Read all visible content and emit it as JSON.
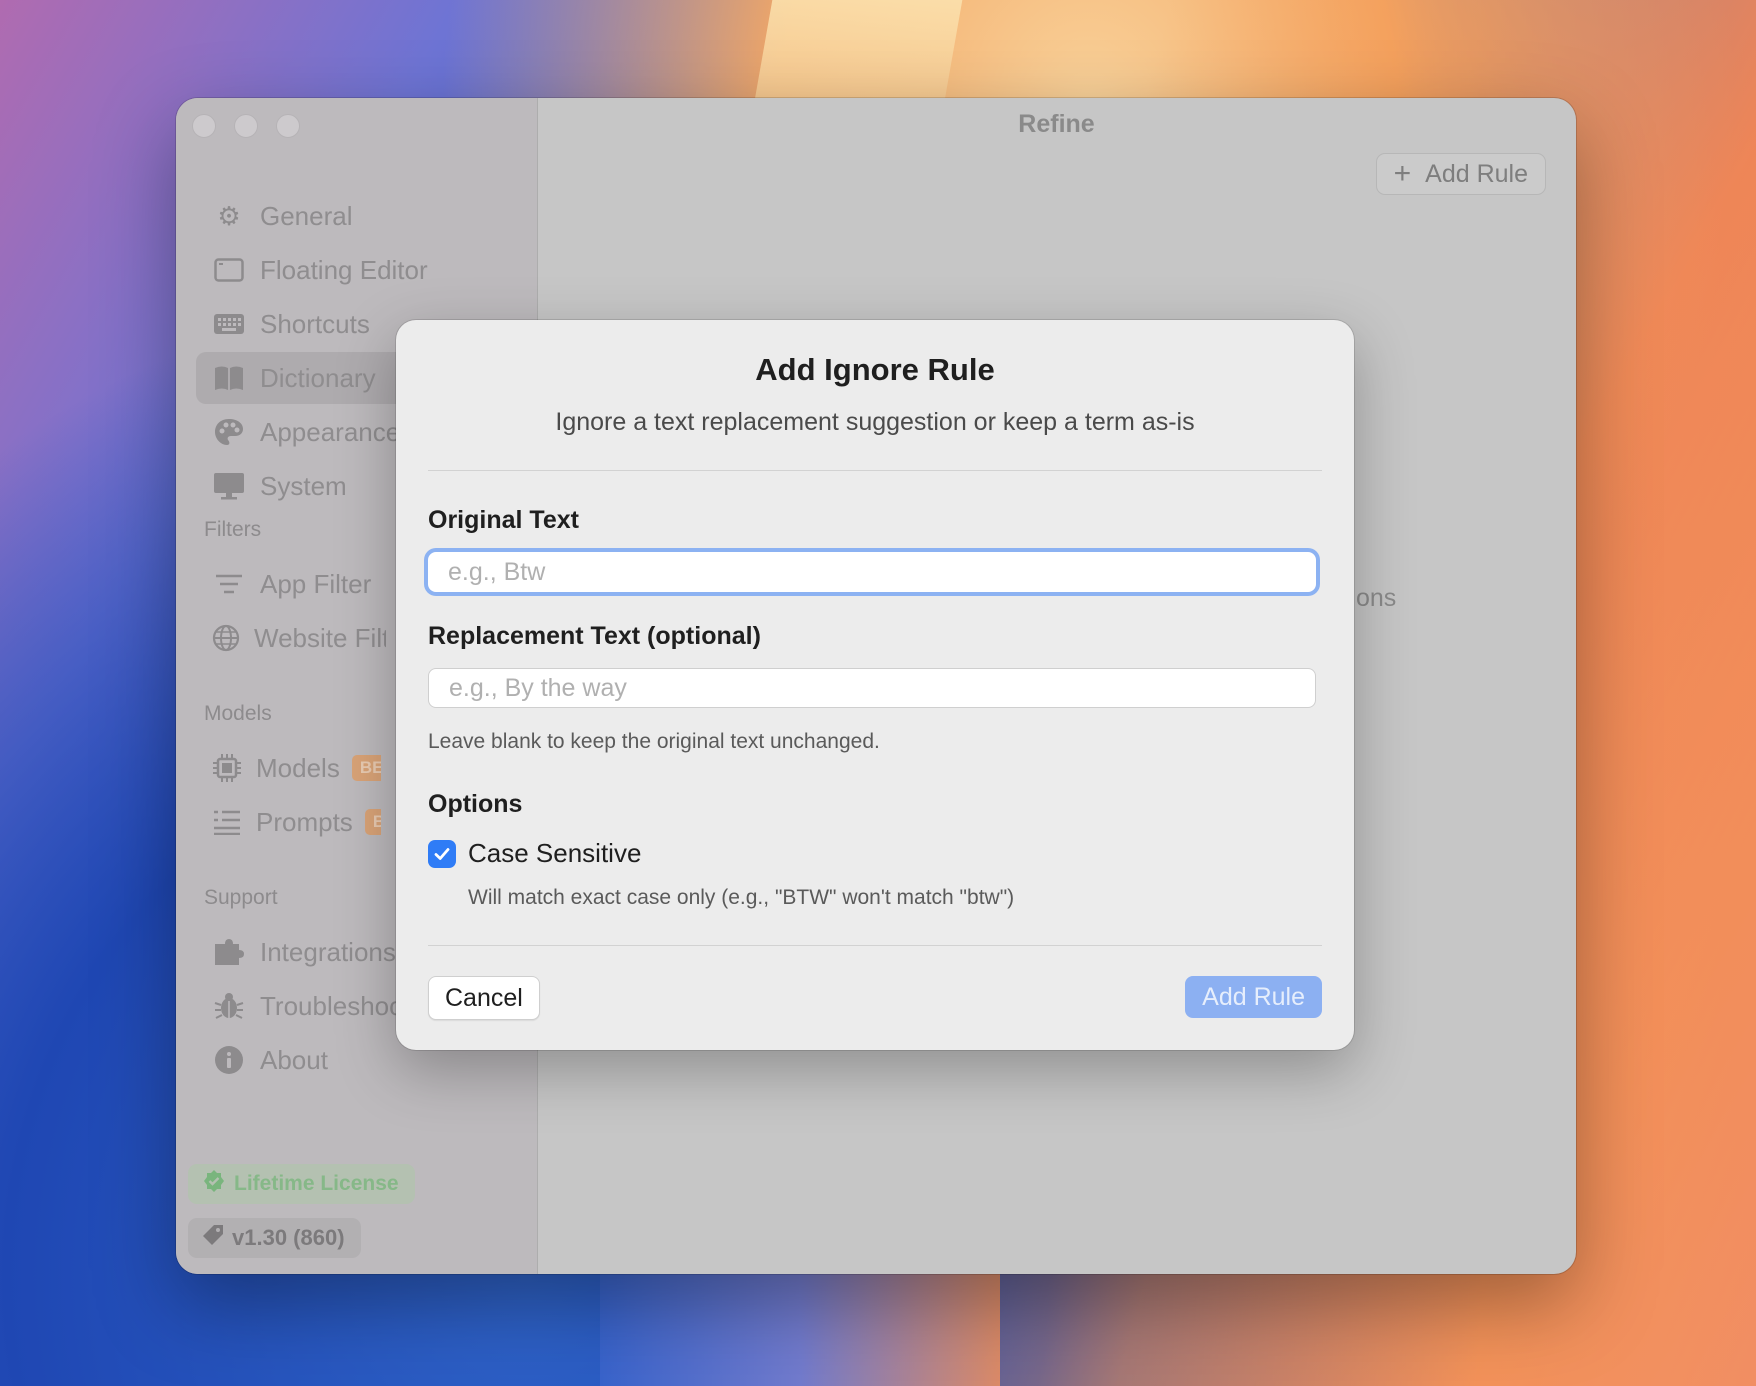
{
  "window": {
    "title": "Refine",
    "add_rule_label": "Add Rule",
    "partial_text": "ons"
  },
  "sidebar": {
    "items": [
      {
        "label": "General",
        "icon": "gear-icon"
      },
      {
        "label": "Floating Editor",
        "icon": "window-icon"
      },
      {
        "label": "Shortcuts",
        "icon": "keyboard-icon"
      },
      {
        "label": "Dictionary",
        "icon": "book-icon",
        "active": true
      },
      {
        "label": "Appearance",
        "icon": "palette-icon"
      },
      {
        "label": "System",
        "icon": "monitor-icon"
      }
    ],
    "sections": {
      "filters": "Filters",
      "models": "Models",
      "support": "Support"
    },
    "filter_items": [
      {
        "label": "App Filter",
        "icon": "filter-icon"
      },
      {
        "label": "Website Filter",
        "icon": "globe-icon"
      }
    ],
    "model_items": [
      {
        "label": "Models",
        "icon": "chip-icon",
        "badge": "BETA"
      },
      {
        "label": "Prompts",
        "icon": "prompts-icon",
        "badge": "BETA"
      }
    ],
    "support_items": [
      {
        "label": "Integrations",
        "icon": "puzzle-icon"
      },
      {
        "label": "Troubleshooting",
        "icon": "bug-icon"
      },
      {
        "label": "About",
        "icon": "info-icon"
      }
    ],
    "license": "Lifetime License",
    "version": "v1.30 (860)"
  },
  "dialog": {
    "title": "Add Ignore Rule",
    "subtitle": "Ignore a text replacement suggestion or keep a term as-is",
    "original_label": "Original Text",
    "original_placeholder": "e.g., Btw",
    "original_value": "",
    "replacement_label": "Replacement Text (optional)",
    "replacement_placeholder": "e.g., By the way",
    "replacement_value": "",
    "replacement_hint": "Leave blank to keep the original text unchanged.",
    "options_label": "Options",
    "case_sensitive_label": "Case Sensitive",
    "case_sensitive_checked": true,
    "case_sensitive_hint": "Will match exact case only (e.g., \"BTW\" won't match \"btw\")",
    "cancel_label": "Cancel",
    "add_label": "Add Rule"
  },
  "colors": {
    "accent": "#2f7cf6",
    "add_button_disabled": "#8cb0f2",
    "license_green": "#5fb864"
  }
}
